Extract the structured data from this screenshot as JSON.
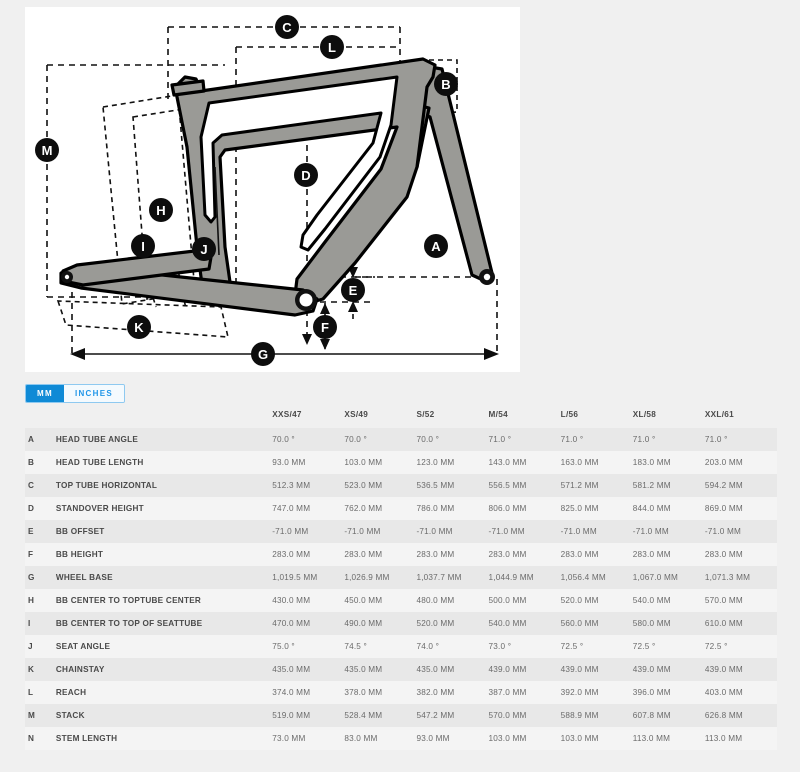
{
  "units": {
    "options": [
      {
        "label": "MM",
        "active": true
      },
      {
        "label": "INCHES",
        "active": false
      }
    ],
    "active_color": "#0f8ad6",
    "inactive_color": "#2196e8"
  },
  "diagram": {
    "name": "bicycle-frame-geometry-diagram",
    "callouts": [
      "A",
      "B",
      "C",
      "D",
      "E",
      "F",
      "G",
      "H",
      "I",
      "J",
      "K",
      "L",
      "M"
    ],
    "frame_fill": "#9a9a96",
    "outline_color": "#000000"
  },
  "table": {
    "columns": [
      "",
      "",
      "XXS/47",
      "XS/49",
      "S/52",
      "M/54",
      "L/56",
      "XL/58",
      "XXL/61"
    ],
    "rows": [
      {
        "letter": "A",
        "name": "HEAD TUBE ANGLE",
        "values": [
          "70.0 °",
          "70.0 °",
          "70.0 °",
          "71.0 °",
          "71.0 °",
          "71.0 °",
          "71.0 °"
        ]
      },
      {
        "letter": "B",
        "name": "HEAD TUBE LENGTH",
        "values": [
          "93.0 MM",
          "103.0 MM",
          "123.0 MM",
          "143.0 MM",
          "163.0 MM",
          "183.0 MM",
          "203.0 MM"
        ]
      },
      {
        "letter": "C",
        "name": "TOP TUBE HORIZONTAL",
        "values": [
          "512.3 MM",
          "523.0 MM",
          "536.5 MM",
          "556.5 MM",
          "571.2 MM",
          "581.2 MM",
          "594.2 MM"
        ]
      },
      {
        "letter": "D",
        "name": "STANDOVER HEIGHT",
        "values": [
          "747.0 MM",
          "762.0 MM",
          "786.0 MM",
          "806.0 MM",
          "825.0 MM",
          "844.0 MM",
          "869.0 MM"
        ]
      },
      {
        "letter": "E",
        "name": "BB OFFSET",
        "values": [
          "-71.0 MM",
          "-71.0 MM",
          "-71.0 MM",
          "-71.0 MM",
          "-71.0 MM",
          "-71.0 MM",
          "-71.0 MM"
        ]
      },
      {
        "letter": "F",
        "name": "BB HEIGHT",
        "values": [
          "283.0 MM",
          "283.0 MM",
          "283.0 MM",
          "283.0 MM",
          "283.0 MM",
          "283.0 MM",
          "283.0 MM"
        ]
      },
      {
        "letter": "G",
        "name": "WHEEL BASE",
        "values": [
          "1,019.5 MM",
          "1,026.9 MM",
          "1,037.7 MM",
          "1,044.9 MM",
          "1,056.4 MM",
          "1,067.0 MM",
          "1,071.3 MM"
        ]
      },
      {
        "letter": "H",
        "name": "BB CENTER TO TOPTUBE CENTER",
        "values": [
          "430.0 MM",
          "450.0 MM",
          "480.0 MM",
          "500.0 MM",
          "520.0 MM",
          "540.0 MM",
          "570.0 MM"
        ]
      },
      {
        "letter": "I",
        "name": "BB CENTER TO TOP OF SEATTUBE",
        "values": [
          "470.0 MM",
          "490.0 MM",
          "520.0 MM",
          "540.0 MM",
          "560.0 MM",
          "580.0 MM",
          "610.0 MM"
        ]
      },
      {
        "letter": "J",
        "name": "SEAT ANGLE",
        "values": [
          "75.0 °",
          "74.5 °",
          "74.0 °",
          "73.0 °",
          "72.5 °",
          "72.5 °",
          "72.5 °"
        ]
      },
      {
        "letter": "K",
        "name": "CHAINSTAY",
        "values": [
          "435.0 MM",
          "435.0 MM",
          "435.0 MM",
          "439.0 MM",
          "439.0 MM",
          "439.0 MM",
          "439.0 MM"
        ]
      },
      {
        "letter": "L",
        "name": "REACH",
        "values": [
          "374.0 MM",
          "378.0 MM",
          "382.0 MM",
          "387.0 MM",
          "392.0 MM",
          "396.0 MM",
          "403.0 MM"
        ]
      },
      {
        "letter": "M",
        "name": "STACK",
        "values": [
          "519.0 MM",
          "528.4 MM",
          "547.2 MM",
          "570.0 MM",
          "588.9 MM",
          "607.8 MM",
          "626.8 MM"
        ]
      },
      {
        "letter": "N",
        "name": "STEM LENGTH",
        "values": [
          "73.0 MM",
          "83.0 MM",
          "93.0 MM",
          "103.0 MM",
          "103.0 MM",
          "113.0 MM",
          "113.0 MM"
        ]
      }
    ]
  }
}
